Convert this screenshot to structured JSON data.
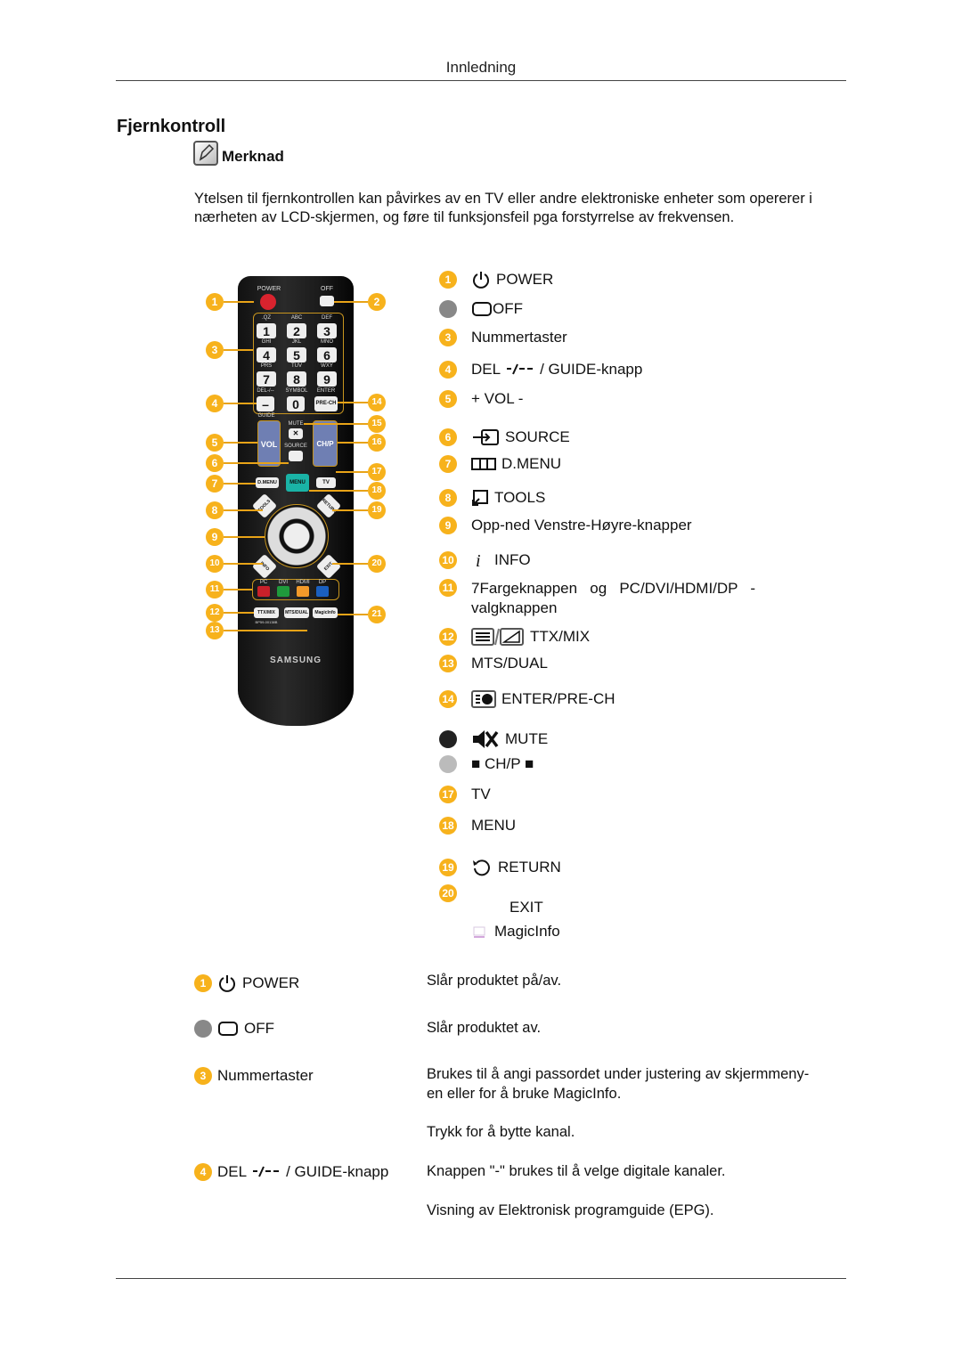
{
  "header": {
    "title": "Innledning"
  },
  "page_title": "Fjernkontroll",
  "note": {
    "icon": "note-pencil-icon",
    "label": "Merknad",
    "text": "Ytelsen til fjernkontrollen kan påvirkes av en TV eller andre elektroniske enheter som opererer i nærheten av LCD-skjermen, og føre til funksjonsfeil pga forstyrrelse av frekvensen."
  },
  "remote": {
    "brand": "SAMSUNG",
    "power_label": "POWER",
    "off_label": "OFF",
    "key_letters": [
      ".QZ",
      "ABC",
      "DEF",
      "GHI",
      "JKL",
      "MNO",
      "PRS",
      "TUV",
      "WXY"
    ],
    "keys": [
      "1",
      "2",
      "3",
      "4",
      "5",
      "6",
      "7",
      "8",
      "9"
    ],
    "del_label": "DEL-/--",
    "del_key": "–",
    "symbol_label": "SYMBOL",
    "zero_key": "0",
    "enter_label": "ENTER",
    "prech_key": "PRE-CH",
    "guide_label": "GUIDE",
    "mute_label": "MUTE",
    "source_label": "SOURCE",
    "vol_label": "VOL",
    "chp_label": "CH/P",
    "dmenu_key": "D.MENU",
    "menu_key": "MENU",
    "tv_key": "TV",
    "tools_key": "TOOLS",
    "return_key": "RETURN",
    "info_key": "INFO",
    "exit_key": "EXIT",
    "color_labels": [
      "PC",
      "DVI",
      "HDMI",
      "DP"
    ],
    "color_keys": [
      "#c8202a",
      "#1f9a3c",
      "#f39a2a",
      "#1a5fbf"
    ],
    "ttx_key": "TTX/MIX",
    "mts_key": "MTS/DUAL",
    "magic_key": "MagicInfo",
    "model": "BP59-00138B",
    "callouts": [
      "1",
      "2",
      "3",
      "4",
      "5",
      "6",
      "7",
      "8",
      "9",
      "10",
      "11",
      "12",
      "13",
      "14",
      "15",
      "16",
      "17",
      "18",
      "19",
      "20",
      "21"
    ]
  },
  "legend": [
    {
      "num": "1",
      "style": "badge",
      "icon": "power-icon",
      "label": "POWER"
    },
    {
      "num": "",
      "style": "gray",
      "icon": "off-screen-icon",
      "label": "OFF"
    },
    {
      "num": "3",
      "style": "badge",
      "icon": "",
      "label": "Nummertaster"
    },
    {
      "num": "4",
      "style": "badge",
      "icon": "",
      "label": "DEL -/-- / GUIDE-knapp"
    },
    {
      "num": "5",
      "style": "badge",
      "icon": "",
      "label": "+ VOL -"
    },
    {
      "num": "6",
      "style": "badge",
      "icon": "source-icon",
      "label": "SOURCE"
    },
    {
      "num": "7",
      "style": "badge",
      "icon": "dmenu-icon",
      "label": "D.MENU"
    },
    {
      "num": "8",
      "style": "badge",
      "icon": "tools-icon",
      "label": "TOOLS"
    },
    {
      "num": "9",
      "style": "badge",
      "icon": "",
      "label": "Opp-ned Venstre-Høyre-knapper"
    },
    {
      "num": "10",
      "style": "badge",
      "icon": "info-icon",
      "label": "INFO"
    },
    {
      "num": "11",
      "style": "badge",
      "icon": "",
      "label": "7Fargeknappen   og   PC/DVI/HDMI/DP   -",
      "label2": "valgknappen"
    },
    {
      "num": "12",
      "style": "badge",
      "icon": "ttx-mix-icon",
      "label": "TTX/MIX"
    },
    {
      "num": "13",
      "style": "badge",
      "icon": "",
      "label": "MTS/DUAL"
    },
    {
      "num": "14",
      "style": "badge",
      "icon": "enter-prech-icon",
      "label": "ENTER/PRE-CH"
    },
    {
      "num": "",
      "style": "dark",
      "icon": "mute-icon",
      "label": "MUTE"
    },
    {
      "num": "",
      "style": "light",
      "icon": "",
      "label": "■ CH/P ■"
    },
    {
      "num": "17",
      "style": "badge",
      "icon": "",
      "label": "TV"
    },
    {
      "num": "18",
      "style": "badge",
      "icon": "",
      "label": "MENU"
    },
    {
      "num": "19",
      "style": "badge",
      "icon": "return-icon",
      "label": "RETURN"
    },
    {
      "num": "20",
      "style": "badge",
      "icon": "",
      "label": "EXIT"
    },
    {
      "num": "",
      "style": "none",
      "icon": "magicinfo-icon",
      "label": "MagicInfo"
    }
  ],
  "table": [
    {
      "num": "1",
      "style": "badge",
      "icon": "power-icon",
      "label": "POWER",
      "desc": [
        "Slår produktet på/av."
      ]
    },
    {
      "num": "",
      "style": "gray",
      "icon": "off-screen-icon",
      "label": "OFF",
      "desc": [
        "Slår produktet av."
      ]
    },
    {
      "num": "3",
      "style": "badge",
      "icon": "",
      "label": "Nummertaster",
      "desc": [
        "Brukes til å angi passordet under justering av skjermmeny-",
        "en eller for å bruke MagicInfo."
      ]
    },
    {
      "num": "4",
      "style": "badge",
      "icon": "",
      "label": "DEL -/-- / GUIDE-knapp",
      "desc": [
        "Trykk for å bytte kanal.",
        "Knappen \"-\" brukes til å velge digitale kanaler.",
        "Visning av Elektronisk programguide (EPG)."
      ]
    }
  ]
}
